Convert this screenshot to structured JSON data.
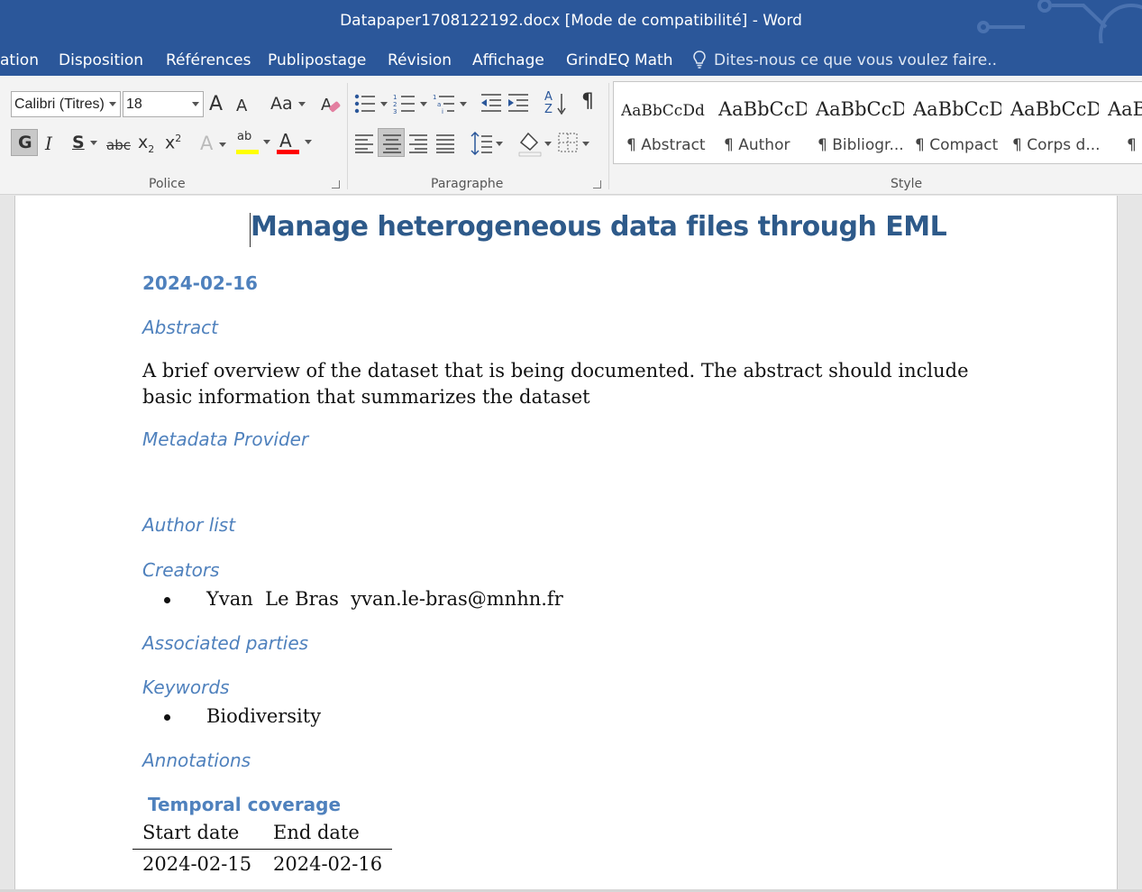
{
  "window": {
    "title": "Datapaper1708122192.docx [Mode de compatibilité] - Word"
  },
  "menu": {
    "tabs": [
      "ation",
      "Disposition",
      "Références",
      "Publipostage",
      "Révision",
      "Affichage",
      "GrindEQ Math"
    ],
    "tell_me": "Dites-nous ce que vous voulez faire.."
  },
  "ribbon": {
    "font_name": "Calibri (Titres)",
    "font_size": "18",
    "groups": {
      "police": "Police",
      "paragraphe": "Paragraphe",
      "style": "Style"
    },
    "buttons": {
      "grow": "A",
      "shrink": "A",
      "case": "Aa",
      "bold": "G",
      "italic": "I",
      "underline": "S",
      "strike": "abc",
      "subscript": "x",
      "superscript": "x",
      "effects": "A",
      "highlight": "ab",
      "font_color": "A",
      "pilcrow": "¶",
      "sort": "A"
    },
    "styles": [
      {
        "sample": "AaBbCcDd",
        "name": "¶ Abstract"
      },
      {
        "sample": "AaBbCcD",
        "name": "¶ Author"
      },
      {
        "sample": "AaBbCcD",
        "name": "¶ Bibliogr..."
      },
      {
        "sample": "AaBbCcD",
        "name": "¶ Compact"
      },
      {
        "sample": "AaBbCcD",
        "name": "¶ Corps d..."
      },
      {
        "sample": "AaB",
        "name": "¶ D"
      }
    ],
    "colors": {
      "highlight": "#ffff00",
      "font_color": "#ff0000"
    }
  },
  "document": {
    "title": "Manage heterogeneous data files through EML",
    "date": "2024-02-16",
    "abstract_heading": "Abstract",
    "abstract_text": "A brief overview of the dataset that is being documented. The abstract should include basic information that summarizes the dataset",
    "metadata_provider_heading": "Metadata Provider",
    "author_list_heading": "Author list",
    "creators_heading": "Creators",
    "creators": [
      "Yvan  Le Bras  yvan.le-bras@mnhn.fr"
    ],
    "associated_parties_heading": "Associated parties",
    "keywords_heading": "Keywords",
    "keywords": [
      "Biodiversity"
    ],
    "annotations_heading": "Annotations",
    "temporal_coverage": {
      "caption": "Temporal coverage",
      "headers": [
        "Start date",
        "End date"
      ],
      "row": [
        "2024-02-15",
        "2024-02-16"
      ]
    }
  }
}
